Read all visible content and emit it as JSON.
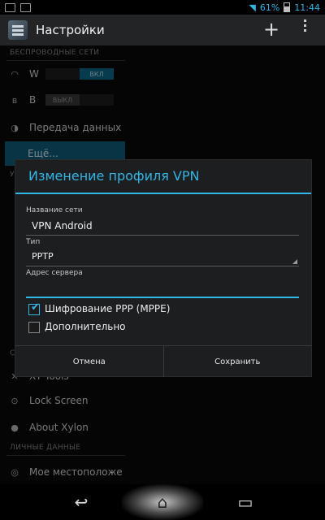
{
  "status_bar": {
    "battery": "61%",
    "time": "11:44",
    "icons": [
      "gallery-icon",
      "image-icon",
      "wifi-icon",
      "battery-icon"
    ]
  },
  "action_bar": {
    "title": "Настройки",
    "add_icon": "plus-icon",
    "menu_icon": "overflow-menu-icon"
  },
  "settings": {
    "section_wireless": "БЕСПРОВОДНЫЕ СЕТИ",
    "wifi": {
      "label": "W",
      "toggle": "ВКЛ"
    },
    "bluetooth": {
      "label": "B",
      "toggle": "ВЫКЛ"
    },
    "data_usage": "Передача данных",
    "more": "Ещё...",
    "section_device": "У",
    "section_system": "С",
    "xt_tools": "XT Tools",
    "lock_screen": "Lock Screen",
    "about_xylon": "About Xylon",
    "section_personal": "ЛИЧНЫЕ ДАННЫЕ",
    "location": "Мое местоположе"
  },
  "dialog": {
    "title": "Изменение профиля VPN",
    "name_label": "Название сети",
    "name_value": "VPN Android",
    "type_label": "Тип",
    "type_value": "PPTP",
    "server_label": "Адрес сервера",
    "server_value": "",
    "ppp_encryption": {
      "label": "Шифрование PPP (MPPE)",
      "checked": true
    },
    "advanced": {
      "label": "Дополнительно",
      "checked": false
    },
    "cancel": "Отмена",
    "save": "Сохранить"
  },
  "colors": {
    "accent": "#33b5e5",
    "selected_row": "#10607e",
    "background": "#0a0a0a",
    "dialog": "#1d1e20"
  }
}
